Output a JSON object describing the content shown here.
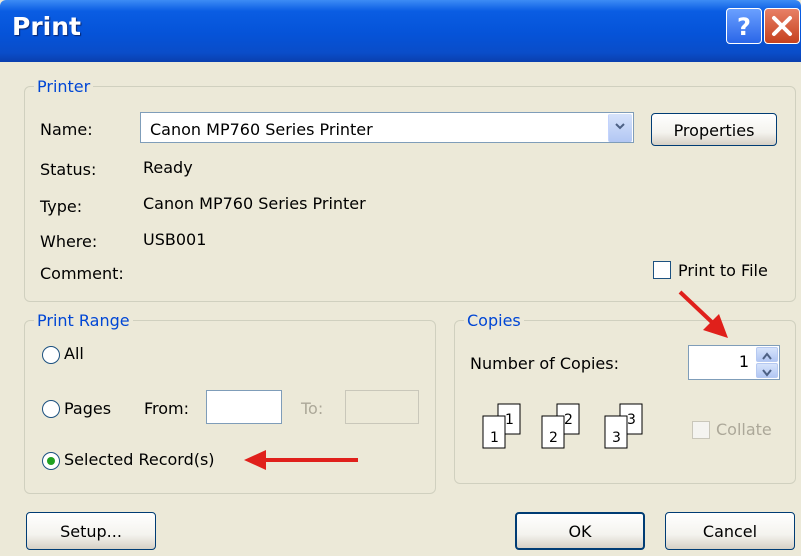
{
  "window": {
    "title": "Print"
  },
  "printer_group": {
    "legend": "Printer",
    "name_label": "Name:",
    "name_value": "Canon MP760 Series Printer",
    "properties_label": "Properties",
    "status_label": "Status:",
    "status_value": "Ready",
    "type_label": "Type:",
    "type_value": "Canon MP760 Series Printer",
    "where_label": "Where:",
    "where_value": "USB001",
    "comment_label": "Comment:",
    "print_to_file_label": "Print to File"
  },
  "range_group": {
    "legend": "Print Range",
    "all_label": "All",
    "pages_label": "Pages",
    "from_label": "From:",
    "to_label": "To:",
    "selected_records_label": "Selected Record(s)",
    "selected_option": "Selected Record(s)"
  },
  "copies_group": {
    "legend": "Copies",
    "number_label": "Number of Copies:",
    "number_value": "1",
    "collate_label": "Collate",
    "collate_icon_pages": [
      "1",
      "1",
      "2",
      "2",
      "3",
      "3"
    ]
  },
  "buttons": {
    "setup_label": "Setup...",
    "ok_label": "OK",
    "cancel_label": "Cancel"
  },
  "colors": {
    "annotation_arrow": "#E0201B",
    "legend_text": "#0046D5",
    "titlebar": "#0A5DE3"
  }
}
